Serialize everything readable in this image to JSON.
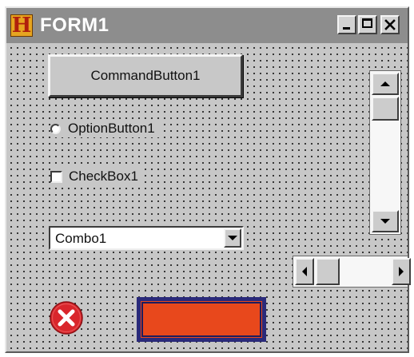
{
  "window": {
    "title": "FORM1",
    "icon": "h-app-icon",
    "controls": {
      "minimize": "minimize-icon",
      "maximize": "maximize-icon",
      "close": "close-icon"
    }
  },
  "form": {
    "command_button": "CommandButton1",
    "option_button": "OptionButton1",
    "check_box": "CheckBox1",
    "combo": "Combo1",
    "vertical_scrollbar": {
      "icon_up": "arrow-up-icon",
      "icon_down": "arrow-down-icon"
    },
    "horizontal_scrollbar": {
      "icon_left": "arrow-left-icon",
      "icon_right": "arrow-right-icon"
    },
    "error_icon": "error-x-icon",
    "shape_fill": "#e8481c",
    "shape_border": "#2a2a7a"
  },
  "colors": {
    "titlebar": "#8d8d8d",
    "form_background": "#c7c7c7",
    "grid_dots": "#202020",
    "error_red": "#d9262c"
  }
}
